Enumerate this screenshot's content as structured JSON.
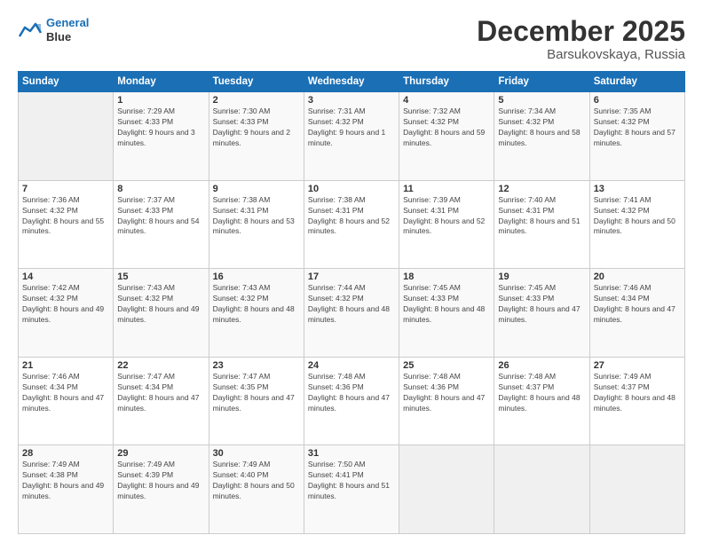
{
  "header": {
    "logo_line1": "General",
    "logo_line2": "Blue",
    "month": "December 2025",
    "location": "Barsukovskaya, Russia"
  },
  "days_of_week": [
    "Sunday",
    "Monday",
    "Tuesday",
    "Wednesday",
    "Thursday",
    "Friday",
    "Saturday"
  ],
  "weeks": [
    [
      {
        "day": "",
        "sunrise": "",
        "sunset": "",
        "daylight": ""
      },
      {
        "day": "1",
        "sunrise": "Sunrise: 7:29 AM",
        "sunset": "Sunset: 4:33 PM",
        "daylight": "Daylight: 9 hours and 3 minutes."
      },
      {
        "day": "2",
        "sunrise": "Sunrise: 7:30 AM",
        "sunset": "Sunset: 4:33 PM",
        "daylight": "Daylight: 9 hours and 2 minutes."
      },
      {
        "day": "3",
        "sunrise": "Sunrise: 7:31 AM",
        "sunset": "Sunset: 4:32 PM",
        "daylight": "Daylight: 9 hours and 1 minute."
      },
      {
        "day": "4",
        "sunrise": "Sunrise: 7:32 AM",
        "sunset": "Sunset: 4:32 PM",
        "daylight": "Daylight: 8 hours and 59 minutes."
      },
      {
        "day": "5",
        "sunrise": "Sunrise: 7:34 AM",
        "sunset": "Sunset: 4:32 PM",
        "daylight": "Daylight: 8 hours and 58 minutes."
      },
      {
        "day": "6",
        "sunrise": "Sunrise: 7:35 AM",
        "sunset": "Sunset: 4:32 PM",
        "daylight": "Daylight: 8 hours and 57 minutes."
      }
    ],
    [
      {
        "day": "7",
        "sunrise": "Sunrise: 7:36 AM",
        "sunset": "Sunset: 4:32 PM",
        "daylight": "Daylight: 8 hours and 55 minutes."
      },
      {
        "day": "8",
        "sunrise": "Sunrise: 7:37 AM",
        "sunset": "Sunset: 4:33 PM",
        "daylight": "Daylight: 8 hours and 54 minutes."
      },
      {
        "day": "9",
        "sunrise": "Sunrise: 7:38 AM",
        "sunset": "Sunset: 4:31 PM",
        "daylight": "Daylight: 8 hours and 53 minutes."
      },
      {
        "day": "10",
        "sunrise": "Sunrise: 7:38 AM",
        "sunset": "Sunset: 4:31 PM",
        "daylight": "Daylight: 8 hours and 52 minutes."
      },
      {
        "day": "11",
        "sunrise": "Sunrise: 7:39 AM",
        "sunset": "Sunset: 4:31 PM",
        "daylight": "Daylight: 8 hours and 52 minutes."
      },
      {
        "day": "12",
        "sunrise": "Sunrise: 7:40 AM",
        "sunset": "Sunset: 4:31 PM",
        "daylight": "Daylight: 8 hours and 51 minutes."
      },
      {
        "day": "13",
        "sunrise": "Sunrise: 7:41 AM",
        "sunset": "Sunset: 4:32 PM",
        "daylight": "Daylight: 8 hours and 50 minutes."
      }
    ],
    [
      {
        "day": "14",
        "sunrise": "Sunrise: 7:42 AM",
        "sunset": "Sunset: 4:32 PM",
        "daylight": "Daylight: 8 hours and 49 minutes."
      },
      {
        "day": "15",
        "sunrise": "Sunrise: 7:43 AM",
        "sunset": "Sunset: 4:32 PM",
        "daylight": "Daylight: 8 hours and 49 minutes."
      },
      {
        "day": "16",
        "sunrise": "Sunrise: 7:43 AM",
        "sunset": "Sunset: 4:32 PM",
        "daylight": "Daylight: 8 hours and 48 minutes."
      },
      {
        "day": "17",
        "sunrise": "Sunrise: 7:44 AM",
        "sunset": "Sunset: 4:32 PM",
        "daylight": "Daylight: 8 hours and 48 minutes."
      },
      {
        "day": "18",
        "sunrise": "Sunrise: 7:45 AM",
        "sunset": "Sunset: 4:33 PM",
        "daylight": "Daylight: 8 hours and 48 minutes."
      },
      {
        "day": "19",
        "sunrise": "Sunrise: 7:45 AM",
        "sunset": "Sunset: 4:33 PM",
        "daylight": "Daylight: 8 hours and 47 minutes."
      },
      {
        "day": "20",
        "sunrise": "Sunrise: 7:46 AM",
        "sunset": "Sunset: 4:34 PM",
        "daylight": "Daylight: 8 hours and 47 minutes."
      }
    ],
    [
      {
        "day": "21",
        "sunrise": "Sunrise: 7:46 AM",
        "sunset": "Sunset: 4:34 PM",
        "daylight": "Daylight: 8 hours and 47 minutes."
      },
      {
        "day": "22",
        "sunrise": "Sunrise: 7:47 AM",
        "sunset": "Sunset: 4:34 PM",
        "daylight": "Daylight: 8 hours and 47 minutes."
      },
      {
        "day": "23",
        "sunrise": "Sunrise: 7:47 AM",
        "sunset": "Sunset: 4:35 PM",
        "daylight": "Daylight: 8 hours and 47 minutes."
      },
      {
        "day": "24",
        "sunrise": "Sunrise: 7:48 AM",
        "sunset": "Sunset: 4:36 PM",
        "daylight": "Daylight: 8 hours and 47 minutes."
      },
      {
        "day": "25",
        "sunrise": "Sunrise: 7:48 AM",
        "sunset": "Sunset: 4:36 PM",
        "daylight": "Daylight: 8 hours and 47 minutes."
      },
      {
        "day": "26",
        "sunrise": "Sunrise: 7:48 AM",
        "sunset": "Sunset: 4:37 PM",
        "daylight": "Daylight: 8 hours and 48 minutes."
      },
      {
        "day": "27",
        "sunrise": "Sunrise: 7:49 AM",
        "sunset": "Sunset: 4:37 PM",
        "daylight": "Daylight: 8 hours and 48 minutes."
      }
    ],
    [
      {
        "day": "28",
        "sunrise": "Sunrise: 7:49 AM",
        "sunset": "Sunset: 4:38 PM",
        "daylight": "Daylight: 8 hours and 49 minutes."
      },
      {
        "day": "29",
        "sunrise": "Sunrise: 7:49 AM",
        "sunset": "Sunset: 4:39 PM",
        "daylight": "Daylight: 8 hours and 49 minutes."
      },
      {
        "day": "30",
        "sunrise": "Sunrise: 7:49 AM",
        "sunset": "Sunset: 4:40 PM",
        "daylight": "Daylight: 8 hours and 50 minutes."
      },
      {
        "day": "31",
        "sunrise": "Sunrise: 7:50 AM",
        "sunset": "Sunset: 4:41 PM",
        "daylight": "Daylight: 8 hours and 51 minutes."
      },
      {
        "day": "",
        "sunrise": "",
        "sunset": "",
        "daylight": ""
      },
      {
        "day": "",
        "sunrise": "",
        "sunset": "",
        "daylight": ""
      },
      {
        "day": "",
        "sunrise": "",
        "sunset": "",
        "daylight": ""
      }
    ]
  ]
}
